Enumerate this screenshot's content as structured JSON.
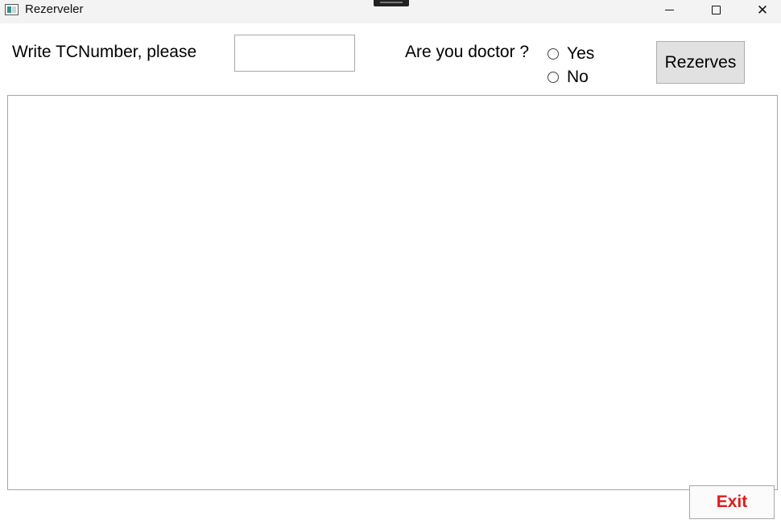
{
  "window": {
    "title": "Rezerveler",
    "controls": [
      "minimize-icon",
      "maximize-icon",
      "close-icon"
    ],
    "close_glyph": "✕"
  },
  "form": {
    "tc_label": "Write TCNumber, please",
    "tc_value": "",
    "doctor_label": "Are you doctor ?",
    "radio_yes": "Yes",
    "radio_no": "No",
    "rezerves_button": "Rezerves"
  },
  "footer": {
    "exit_button": "Exit"
  },
  "colors": {
    "titlebar_bg": "#f3f3f3",
    "button_bg": "#e1e1e1",
    "exit_text": "#e01b1b"
  }
}
